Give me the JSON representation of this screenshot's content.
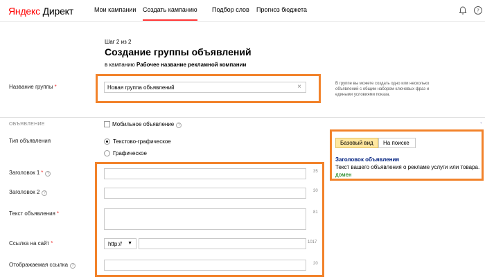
{
  "header": {
    "logo_ya": "Яндекс",
    "logo_brand": "Директ",
    "nav": [
      "Мои кампании",
      "Создать кампанию",
      "Подбор слов",
      "Прогноз бюджета"
    ],
    "icons": [
      "bell-icon",
      "help-icon"
    ]
  },
  "page": {
    "step": "Шаг 2 из 2",
    "title": "Создание группы объявлений",
    "campaign_prefix": "в кампанию",
    "campaign_name": "Рабочее название рекламной компании"
  },
  "group": {
    "label": "Название группы",
    "value": "Новая группа объявлений",
    "hint": "В группе вы можете создать одно или несколько объявлений с общим набором ключевых фраз и едиными условиями показа."
  },
  "ad": {
    "section": "ОБЪЯВЛЕНИЕ",
    "mobile_label": "Мобильное объявление",
    "type_label": "Тип объявления",
    "types": [
      "Текстово-графическое",
      "Графическое"
    ],
    "fields": {
      "title1": {
        "label": "Заголовок 1",
        "counter": "35"
      },
      "title2": {
        "label": "Заголовок 2",
        "counter": "30"
      },
      "text": {
        "label": "Текст объявления",
        "counter": "81"
      },
      "url": {
        "label": "Ссылка на сайт",
        "protocol": "http://",
        "counter": "1017"
      },
      "display": {
        "label": "Отображаемая ссылка",
        "counter": "20"
      }
    }
  },
  "preview": {
    "tabs": [
      "Базовый вид",
      "На поиске"
    ],
    "title": "Заголовок объявления",
    "text": "Текст вашего объявления о рекламе услуги или товара.",
    "domain": "домен"
  },
  "colors": {
    "accent": "#f2822a",
    "nav_underline": "#ff3333",
    "preview_tab": "#ffe7a0"
  }
}
